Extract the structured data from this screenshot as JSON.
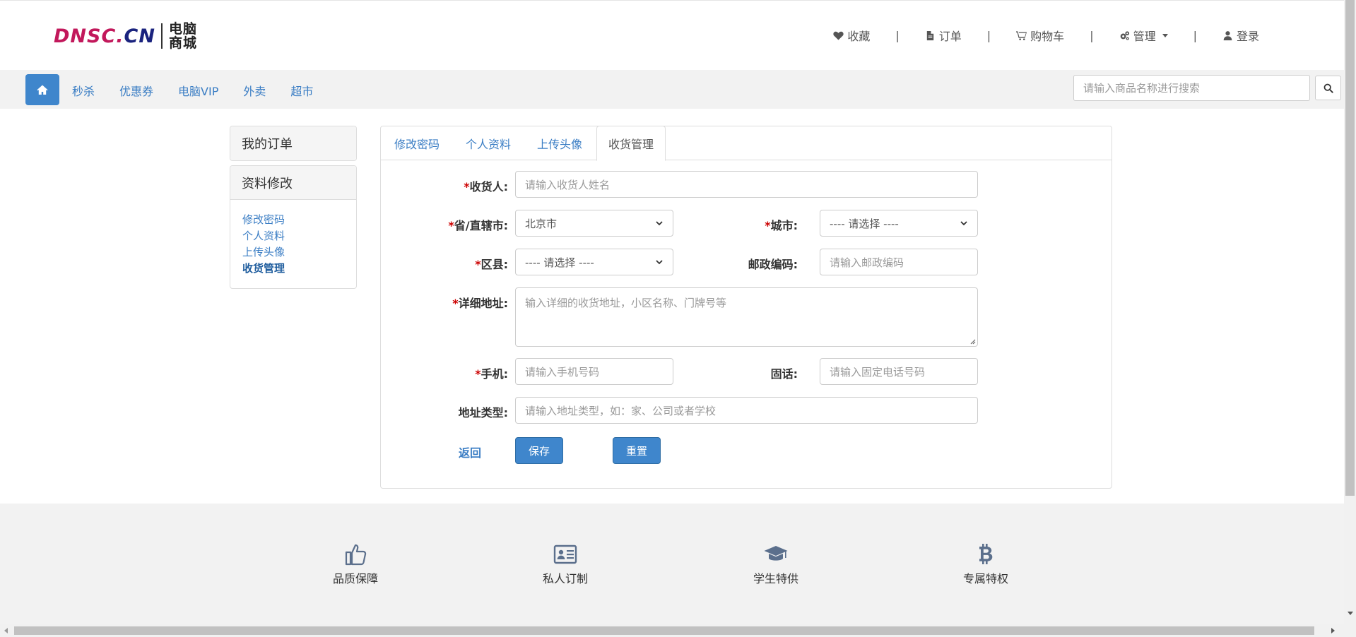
{
  "logo": {
    "part1": "DNSC.",
    "part2": "CN",
    "sub_line1": "电脑",
    "sub_line2": "商城"
  },
  "topnav": [
    {
      "icon": "heart-icon",
      "label": "收藏"
    },
    {
      "icon": "file-icon",
      "label": "订单"
    },
    {
      "icon": "cart-icon",
      "label": "购物车"
    },
    {
      "icon": "gears-icon",
      "label": "管理"
    },
    {
      "icon": "user-icon",
      "label": "登录"
    }
  ],
  "topnav_separator": "|",
  "navbar": {
    "links": [
      "秒杀",
      "优惠券",
      "电脑VIP",
      "外卖",
      "超市"
    ],
    "search_placeholder": "请输入商品名称进行搜索"
  },
  "sidebar": {
    "orders_title": "我的订单",
    "profile_title": "资料修改",
    "links": [
      "修改密码",
      "个人资料",
      "上传头像",
      "收货管理"
    ],
    "active_link": "收货管理"
  },
  "tabs": [
    "修改密码",
    "个人资料",
    "上传头像",
    "收货管理"
  ],
  "active_tab": "收货管理",
  "form": {
    "required_mark": "*",
    "receiver_label": "收货人:",
    "receiver_placeholder": "请输入收货人姓名",
    "province_label": "省/直辖市:",
    "province_value": "北京市",
    "city_label": "城市:",
    "city_value": "---- 请选择 ----",
    "district_label": "区县:",
    "district_value": "---- 请选择 ----",
    "postcode_label": "邮政编码:",
    "postcode_placeholder": "请输入邮政编码",
    "address_label": "详细地址:",
    "address_placeholder": "输入详细的收货地址，小区名称、门牌号等",
    "mobile_label": "手机:",
    "mobile_placeholder": "请输入手机号码",
    "phone_label": "固话:",
    "phone_placeholder": "请输入固定电话号码",
    "type_label": "地址类型:",
    "type_placeholder": "请输入地址类型，如：家、公司或者学校",
    "back_label": "返回",
    "save_label": "保存",
    "reset_label": "重置"
  },
  "footer": [
    {
      "icon": "thumbs-up-icon",
      "label": "品质保障"
    },
    {
      "icon": "id-card-icon",
      "label": "私人订制"
    },
    {
      "icon": "graduation-cap-icon",
      "label": "学生特供"
    },
    {
      "icon": "bitcoin-icon",
      "label": "专属特权"
    }
  ],
  "colors": {
    "primary": "#3f86cc",
    "link": "#3a7dc4",
    "required": "#cc0000",
    "logo_pink": "#c2185b",
    "logo_navy": "#1a237e"
  }
}
